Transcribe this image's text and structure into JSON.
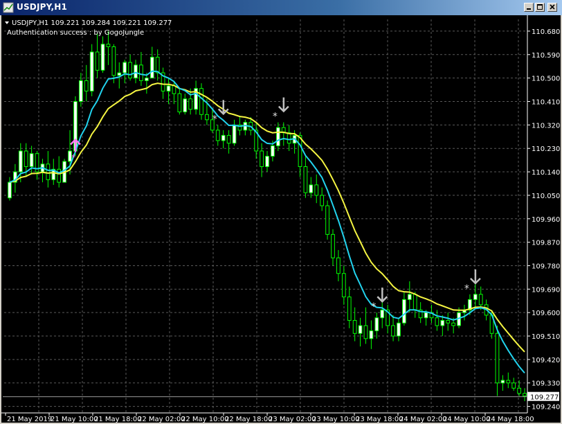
{
  "window": {
    "title": "USDJPY,H1",
    "buttons": [
      "minimize",
      "maximize",
      "close"
    ]
  },
  "chart": {
    "symbol_line": "USDJPY,H1  109.221 109.284 109.221 109.277",
    "auth_line": "Authentication success : by GogoJungle",
    "dropdown_icon": "triangle-down-icon",
    "current_price_label": "109.277",
    "colors": {
      "background": "#000000",
      "grid": "#5a5a5a",
      "candle": "#00ff00",
      "bull_body": "#ffffff",
      "bear_body": "#000000",
      "ma_fast": "#22d3ee",
      "ma_slow": "#f5f542",
      "arrow_up": "#ff7af5",
      "arrow_down": "#c0c0c0"
    }
  },
  "chart_data": {
    "type": "candlestick",
    "symbol": "USDJPY",
    "timeframe": "H1",
    "price_axis": [
      "110.680",
      "110.590",
      "110.500",
      "110.410",
      "110.320",
      "110.230",
      "110.140",
      "110.050",
      "109.960",
      "109.870",
      "109.780",
      "109.690",
      "109.600",
      "109.510",
      "109.420",
      "109.330",
      "109.240"
    ],
    "ylim": [
      109.215,
      110.725
    ],
    "time_axis": [
      "21 May 2019",
      "21 May 10:00",
      "21 May 18:00",
      "22 May 02:00",
      "22 May 10:00",
      "22 May 18:00",
      "23 May 02:00",
      "23 May 10:00",
      "23 May 18:00",
      "24 May 02:00",
      "24 May 10:00",
      "24 May 18:00"
    ],
    "last_price": 109.277,
    "candles": [
      [
        110.04,
        110.12,
        110.03,
        110.1
      ],
      [
        110.1,
        110.17,
        110.06,
        110.14
      ],
      [
        110.14,
        110.25,
        110.1,
        110.22
      ],
      [
        110.22,
        110.25,
        110.12,
        110.16
      ],
      [
        110.16,
        110.24,
        110.13,
        110.21
      ],
      [
        110.21,
        110.22,
        110.11,
        110.14
      ],
      [
        110.14,
        110.19,
        110.1,
        110.17
      ],
      [
        110.17,
        110.22,
        110.08,
        110.11
      ],
      [
        110.11,
        110.19,
        110.09,
        110.15
      ],
      [
        110.15,
        110.2,
        110.08,
        110.1
      ],
      [
        110.1,
        110.19,
        110.1,
        110.18
      ],
      [
        110.18,
        110.3,
        110.13,
        110.22
      ],
      [
        110.22,
        110.43,
        110.2,
        110.41
      ],
      [
        110.41,
        110.52,
        110.39,
        110.49
      ],
      [
        110.49,
        110.55,
        110.41,
        110.45
      ],
      [
        110.45,
        110.63,
        110.43,
        110.6
      ],
      [
        110.6,
        110.67,
        110.5,
        110.53
      ],
      [
        110.53,
        110.66,
        110.52,
        110.63
      ],
      [
        110.63,
        110.68,
        110.55,
        110.62
      ],
      [
        110.62,
        110.63,
        110.48,
        110.51
      ],
      [
        110.51,
        110.56,
        110.46,
        110.52
      ],
      [
        110.52,
        110.57,
        110.48,
        110.56
      ],
      [
        110.56,
        110.59,
        110.49,
        110.5
      ],
      [
        110.5,
        110.57,
        110.48,
        110.55
      ],
      [
        110.55,
        110.6,
        110.47,
        110.49
      ],
      [
        110.49,
        110.52,
        110.44,
        110.5
      ],
      [
        110.5,
        110.62,
        110.5,
        110.58
      ],
      [
        110.58,
        110.61,
        110.49,
        110.52
      ],
      [
        110.52,
        110.54,
        110.42,
        110.45
      ],
      [
        110.45,
        110.5,
        110.4,
        110.47
      ],
      [
        110.47,
        110.49,
        110.4,
        110.44
      ],
      [
        110.44,
        110.46,
        110.36,
        110.37
      ],
      [
        110.37,
        110.44,
        110.36,
        110.42
      ],
      [
        110.42,
        110.46,
        110.36,
        110.38
      ],
      [
        110.38,
        110.49,
        110.36,
        110.46
      ],
      [
        110.46,
        110.48,
        110.34,
        110.36
      ],
      [
        110.36,
        110.42,
        110.32,
        110.34
      ],
      [
        110.34,
        110.38,
        110.29,
        110.3
      ],
      [
        110.3,
        110.32,
        110.24,
        110.26
      ],
      [
        110.26,
        110.3,
        110.23,
        110.28
      ],
      [
        110.28,
        110.3,
        110.21,
        110.25
      ],
      [
        110.25,
        110.34,
        110.24,
        110.32
      ],
      [
        110.32,
        110.35,
        110.28,
        110.3
      ],
      [
        110.3,
        110.34,
        110.28,
        110.33
      ],
      [
        110.33,
        110.35,
        110.28,
        110.3
      ],
      [
        110.3,
        110.33,
        110.19,
        110.22
      ],
      [
        110.22,
        110.25,
        110.12,
        110.16
      ],
      [
        110.16,
        110.22,
        110.14,
        110.2
      ],
      [
        110.2,
        110.26,
        110.18,
        110.24
      ],
      [
        110.24,
        110.33,
        110.22,
        110.31
      ],
      [
        110.31,
        110.33,
        110.24,
        110.29
      ],
      [
        110.29,
        110.32,
        110.22,
        110.25
      ],
      [
        110.25,
        110.3,
        110.21,
        110.28
      ],
      [
        110.28,
        110.29,
        110.12,
        110.16
      ],
      [
        110.16,
        110.2,
        110.04,
        110.06
      ],
      [
        110.06,
        110.12,
        110.04,
        110.09
      ],
      [
        110.09,
        110.13,
        110.02,
        110.05
      ],
      [
        110.05,
        110.08,
        109.99,
        110.01
      ],
      [
        110.01,
        110.03,
        109.88,
        109.9
      ],
      [
        109.9,
        109.92,
        109.78,
        109.81
      ],
      [
        109.81,
        109.84,
        109.72,
        109.75
      ],
      [
        109.75,
        109.78,
        109.63,
        109.66
      ],
      [
        109.66,
        109.7,
        109.54,
        109.57
      ],
      [
        109.57,
        109.62,
        109.49,
        109.52
      ],
      [
        109.52,
        109.58,
        109.47,
        109.55
      ],
      [
        109.55,
        109.62,
        109.48,
        109.5
      ],
      [
        109.5,
        109.57,
        109.46,
        109.53
      ],
      [
        109.53,
        109.6,
        109.5,
        109.58
      ],
      [
        109.58,
        109.64,
        109.54,
        109.61
      ],
      [
        109.61,
        109.63,
        109.52,
        109.55
      ],
      [
        109.55,
        109.59,
        109.49,
        109.51
      ],
      [
        109.51,
        109.58,
        109.49,
        109.56
      ],
      [
        109.56,
        109.68,
        109.55,
        109.65
      ],
      [
        109.65,
        109.72,
        109.6,
        109.67
      ],
      [
        109.67,
        109.68,
        109.58,
        109.61
      ],
      [
        109.61,
        109.64,
        109.56,
        109.58
      ],
      [
        109.58,
        109.61,
        109.55,
        109.6
      ],
      [
        109.6,
        109.63,
        109.56,
        109.58
      ],
      [
        109.58,
        109.61,
        109.53,
        109.55
      ],
      [
        109.55,
        109.59,
        109.51,
        109.57
      ],
      [
        109.57,
        109.6,
        109.53,
        109.56
      ],
      [
        109.56,
        109.58,
        109.52,
        109.55
      ],
      [
        109.55,
        109.62,
        109.54,
        109.6
      ],
      [
        109.6,
        109.63,
        109.57,
        109.61
      ],
      [
        109.61,
        109.67,
        109.59,
        109.65
      ],
      [
        109.65,
        109.71,
        109.62,
        109.67
      ],
      [
        109.67,
        109.7,
        109.61,
        109.63
      ],
      [
        109.63,
        109.65,
        109.57,
        109.59
      ],
      [
        109.59,
        109.61,
        109.5,
        109.52
      ],
      [
        109.52,
        109.55,
        109.28,
        109.33
      ],
      [
        109.33,
        109.36,
        109.3,
        109.34
      ],
      [
        109.34,
        109.37,
        109.31,
        109.33
      ],
      [
        109.33,
        109.35,
        109.3,
        109.31
      ],
      [
        109.31,
        109.34,
        109.28,
        109.29
      ],
      [
        109.29,
        109.31,
        109.26,
        109.28
      ]
    ],
    "series": [
      {
        "name": "ma_fast",
        "color": "#22d3ee"
      },
      {
        "name": "ma_slow",
        "color": "#f5f542"
      }
    ],
    "signals": [
      {
        "type": "buy",
        "index": 12
      },
      {
        "type": "sell",
        "index": 38
      },
      {
        "type": "sell",
        "index": 49
      },
      {
        "type": "sell",
        "index": 67
      },
      {
        "type": "sell",
        "index": 84
      }
    ]
  }
}
